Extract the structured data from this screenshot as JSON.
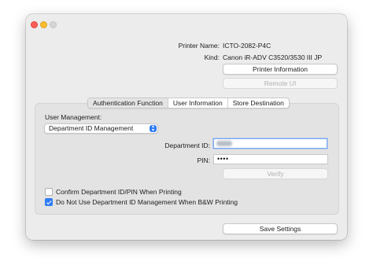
{
  "window": {
    "controls": [
      "close",
      "minimize",
      "maximize"
    ]
  },
  "printer": {
    "name_label": "Printer Name:",
    "name_value": "ICTO-2082-P4C",
    "kind_label": "Kind:",
    "kind_value": "Canon iR-ADV C3520/3530 III JP",
    "info_button": "Printer Information",
    "remote_ui_button": "Remote UI"
  },
  "tabs": [
    {
      "label": "Authentication Function",
      "selected": true
    },
    {
      "label": "User Information",
      "selected": false
    },
    {
      "label": "Store Destination",
      "selected": false
    }
  ],
  "auth": {
    "user_management_label": "User Management:",
    "user_management_value": "Department ID Management",
    "department_id_label": "Department ID:",
    "department_id_value": "",
    "pin_label": "PIN:",
    "pin_value": "••••",
    "verify_button": "Verify",
    "confirm_checkbox": {
      "label": "Confirm Department ID/PIN When Printing",
      "checked": false
    },
    "bw_checkbox": {
      "label": "Do Not Use Department ID Management When B&W Printing",
      "checked": true
    }
  },
  "footer": {
    "save_button": "Save Settings"
  },
  "colors": {
    "accent": "#2f7cf6",
    "close": "#fe5f57",
    "minimize": "#febc2e",
    "window_bg": "#ececec"
  },
  "icons": {
    "select_chevron": "chevron-up-down-icon",
    "checkmark": "checkmark-icon"
  }
}
